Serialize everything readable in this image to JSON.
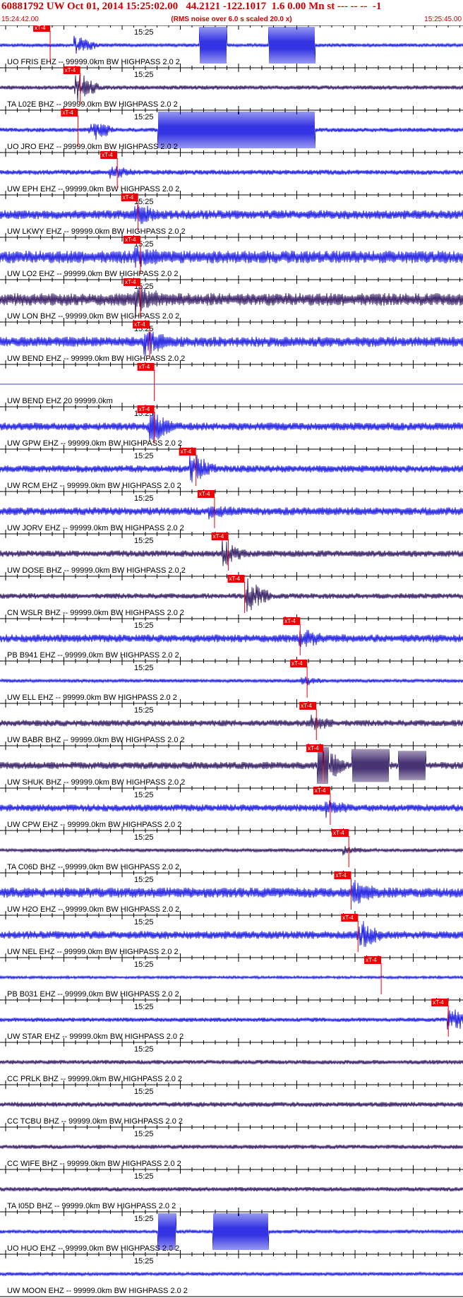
{
  "header": {
    "title": "60881792 UW Oct 01, 2014 15:25:02.00   44.2121 -122.1017  1.6 0.00 Mn st --- -- --  -1",
    "start_time": "15:24:42.00",
    "end_time": "15:25:45.00",
    "rms_note": "(RMS noise over 6.0 s scaled 20.0 x)"
  },
  "time_label": "15:25",
  "pick_label": "xT-4",
  "colors": {
    "blue": "#0000dd",
    "dark": "#1a0050",
    "pick_red": "#ee0000",
    "text": "#000000",
    "header_red": "#cc0000"
  },
  "traces": [
    {
      "label": "UO FRIS EHZ -- 99999.0km BW  HIGHPASS  2.0  2",
      "pick": 0.09,
      "color": "blue",
      "amp": 0.1,
      "seed": 1,
      "time_label": false,
      "ev": [
        0.16,
        0.5
      ],
      "bursts": [
        [
          0.43,
          0.49,
          1.0
        ],
        [
          0.58,
          0.68,
          1.0
        ]
      ]
    },
    {
      "label": "TA L02E BHZ -- 99999.0km BW  HIGHPASS  2.0  2",
      "pick": 0.155,
      "color": "dark",
      "amp": 0.12,
      "seed": 2,
      "time_label": true,
      "ev": [
        0.16,
        0.85
      ],
      "bursts": []
    },
    {
      "label": "UO JRO EHZ -- 99999.0km BW  HIGHPASS  2.0  2",
      "pick": 0.15,
      "color": "blue",
      "amp": 0.12,
      "seed": 3,
      "time_label": true,
      "ev": [
        0.19,
        0.7
      ],
      "bursts": [
        [
          0.34,
          0.68,
          1.0
        ]
      ]
    },
    {
      "label": "UW EPH EHZ -- 99999.0km BW  HIGHPASS  2.0  2",
      "pick": 0.235,
      "color": "blue",
      "amp": 0.14,
      "seed": 4,
      "time_label": false,
      "ev": [
        0.235,
        0.3
      ],
      "bursts": []
    },
    {
      "label": "UW LKWY EHZ -- 99999.0km BW  HIGHPASS  2.0  2",
      "pick": 0.28,
      "color": "blue",
      "amp": 0.25,
      "seed": 5,
      "time_label": true,
      "ev": [
        0.29,
        0.5
      ],
      "bursts": []
    },
    {
      "label": "UW LO2 EHZ -- 99999.0km BW  HIGHPASS  2.0  2",
      "pick": 0.285,
      "color": "blue",
      "amp": 0.35,
      "seed": 6,
      "time_label": true,
      "ev": [
        0.29,
        0.5
      ],
      "bursts": []
    },
    {
      "label": "UW LON BHZ -- 99999.0km BW  HIGHPASS  2.0  2",
      "pick": 0.285,
      "color": "dark",
      "amp": 0.35,
      "seed": 7,
      "time_label": true,
      "ev": [
        0.29,
        0.8
      ],
      "bursts": []
    },
    {
      "label": "UW BEND EHZ -- 99999.0km BW  HIGHPASS  2.0  2",
      "pick": 0.305,
      "color": "blue",
      "amp": 0.28,
      "seed": 8,
      "time_label": true,
      "ev": [
        0.31,
        0.6
      ],
      "bursts": []
    },
    {
      "label": "UW BEND EHZ 20 99999.0km",
      "pick": 0.315,
      "color": "blue",
      "amp": 0.0,
      "seed": 9,
      "time_label": false,
      "ev": [
        0.31,
        0.0
      ],
      "bursts": []
    },
    {
      "label": "UW GPW EHZ -- 99999.0km BW  HIGHPASS  2.0  2",
      "pick": 0.315,
      "color": "blue",
      "amp": 0.22,
      "seed": 10,
      "time_label": true,
      "ev": [
        0.32,
        0.9
      ],
      "bursts": []
    },
    {
      "label": "UW RCM EHZ -- 99999.0km BW  HIGHPASS  2.0  2",
      "pick": 0.405,
      "color": "blue",
      "amp": 0.2,
      "seed": 11,
      "time_label": true,
      "ev": [
        0.41,
        0.9
      ],
      "bursts": []
    },
    {
      "label": "UW JORV EHZ -- 99999.0km BW  HIGHPASS  2.0  2",
      "pick": 0.445,
      "color": "blue",
      "amp": 0.22,
      "seed": 12,
      "time_label": true,
      "ev": [
        0.45,
        0.3
      ],
      "bursts": []
    },
    {
      "label": "UW DOSE BHZ -- 99999.0km BW  HIGHPASS  2.0  2",
      "pick": 0.475,
      "color": "dark",
      "amp": 0.18,
      "seed": 13,
      "time_label": true,
      "ev": [
        0.48,
        0.6
      ],
      "bursts": []
    },
    {
      "label": "CN WSLR BHZ -- 99999.0km BW  HIGHPASS  2.0  2",
      "pick": 0.51,
      "color": "dark",
      "amp": 0.15,
      "seed": 14,
      "time_label": false,
      "ev": [
        0.53,
        0.9
      ],
      "bursts": []
    },
    {
      "label": "PB B941 EHZ -- 99999.0km BW  HIGHPASS  2.0  2",
      "pick": 0.63,
      "color": "blue",
      "amp": 0.22,
      "seed": 15,
      "time_label": true,
      "ev": [
        0.645,
        0.5
      ],
      "bursts": []
    },
    {
      "label": "UW ELL EHZ -- 99999.0km BW  HIGHPASS  2.0  2",
      "pick": 0.645,
      "color": "blue",
      "amp": 0.1,
      "seed": 16,
      "time_label": true,
      "ev": [
        0.65,
        0.2
      ],
      "bursts": []
    },
    {
      "label": "UW BABR BHZ -- 99999.0km BW  HIGHPASS  2.0  2",
      "pick": 0.665,
      "color": "dark",
      "amp": 0.18,
      "seed": 17,
      "time_label": true,
      "ev": [
        0.67,
        0.3
      ],
      "bursts": []
    },
    {
      "label": "UW SHUK BHZ -- 99999.0km BW  HIGHPASS  2.0  2",
      "pick": 0.68,
      "color": "dark",
      "amp": 0.2,
      "seed": 18,
      "time_label": false,
      "ev": [
        0.69,
        1.0
      ],
      "bursts": [
        [
          0.685,
          0.71,
          1.0
        ],
        [
          0.76,
          0.84,
          0.9
        ],
        [
          0.86,
          0.92,
          0.8
        ]
      ]
    },
    {
      "label": "UW CPW EHZ -- 99999.0km BW  HIGHPASS  2.0  2",
      "pick": 0.695,
      "color": "blue",
      "amp": 0.2,
      "seed": 19,
      "time_label": true,
      "ev": [
        0.7,
        0.4
      ],
      "bursts": []
    },
    {
      "label": "TA C06D BHZ -- 99999.0km BW  HIGHPASS  2.0  2",
      "pick": 0.735,
      "color": "dark",
      "amp": 0.1,
      "seed": 20,
      "time_label": true,
      "ev": [
        0.74,
        0.2
      ],
      "bursts": []
    },
    {
      "label": "UW H2O EHZ -- 99999.0km BW  HIGHPASS  2.0  2",
      "pick": 0.74,
      "color": "blue",
      "amp": 0.28,
      "seed": 21,
      "time_label": true,
      "ev": [
        0.76,
        0.5
      ],
      "bursts": []
    },
    {
      "label": "UW NEL EHZ -- 99999.0km BW  HIGHPASS  2.0  2",
      "pick": 0.755,
      "color": "blue",
      "amp": 0.22,
      "seed": 22,
      "time_label": true,
      "ev": [
        0.77,
        0.8
      ],
      "bursts": []
    },
    {
      "label": "PB B031 EHZ -- 99999.0km BW  HIGHPASS  2.0  2",
      "pick": 0.805,
      "color": "blue",
      "amp": 0.08,
      "seed": 23,
      "time_label": true,
      "ev": [
        0.82,
        0.0
      ],
      "bursts": []
    },
    {
      "label": "UW STAR EHZ -- 99999.0km BW  HIGHPASS  2.0  2",
      "pick": 0.95,
      "color": "blue",
      "amp": 0.12,
      "seed": 24,
      "time_label": true,
      "ev": [
        0.965,
        0.9
      ],
      "bursts": []
    },
    {
      "label": "CC PRLK BHZ -- 99999.0km BW  HIGHPASS  2.0  2",
      "pick": -1,
      "color": "dark",
      "amp": 0.12,
      "seed": 25,
      "time_label": true,
      "ev": [
        0.0,
        0.0
      ],
      "bursts": []
    },
    {
      "label": "CC TCBU BHZ -- 99999.0km BW  HIGHPASS  2.0  2",
      "pick": -1,
      "color": "dark",
      "amp": 0.14,
      "seed": 26,
      "time_label": true,
      "ev": [
        0.0,
        0.0
      ],
      "bursts": []
    },
    {
      "label": "CC WIFE BHZ -- 99999.0km BW  HIGHPASS  2.0  2",
      "pick": -1,
      "color": "dark",
      "amp": 0.12,
      "seed": 27,
      "time_label": true,
      "ev": [
        0.0,
        0.0
      ],
      "bursts": []
    },
    {
      "label": "TA I05D BHZ -- 99999.0km BW  HIGHPASS  2.0  2",
      "pick": -1,
      "color": "dark",
      "amp": 0.12,
      "seed": 28,
      "time_label": true,
      "ev": [
        0.0,
        0.0
      ],
      "bursts": []
    },
    {
      "label": "UO HUO EHZ -- 99999.0km BW  HIGHPASS  2.0  2",
      "pick": -1,
      "color": "blue",
      "amp": 0.1,
      "seed": 29,
      "time_label": true,
      "ev": [
        0.16,
        0.5
      ],
      "bursts": [
        [
          0.34,
          0.38,
          1.0
        ],
        [
          0.46,
          0.58,
          1.0
        ]
      ]
    },
    {
      "label": "UW MOON EHZ -- 99999.0km BW  HIGHPASS  2.0  2",
      "pick": -1,
      "color": "blue",
      "amp": 0.1,
      "seed": 30,
      "time_label": true,
      "ev": [
        0.0,
        0.0
      ],
      "bursts": []
    }
  ]
}
